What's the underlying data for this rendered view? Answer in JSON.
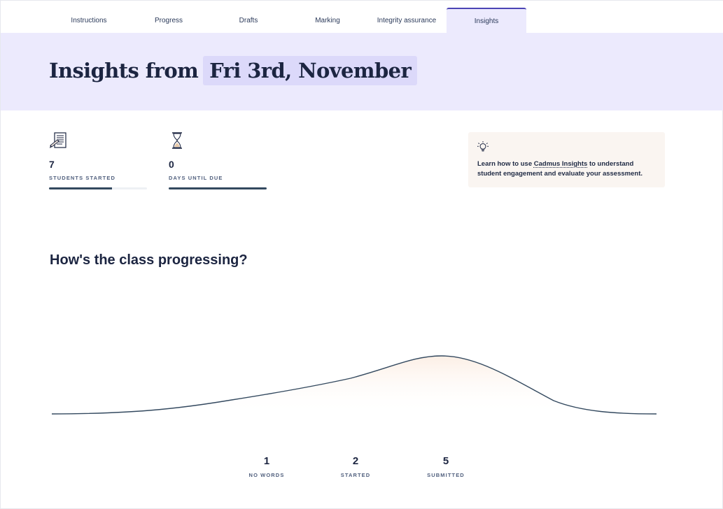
{
  "tabs": [
    {
      "label": "Instructions",
      "active": false
    },
    {
      "label": "Progress",
      "active": false
    },
    {
      "label": "Drafts",
      "active": false
    },
    {
      "label": "Marking",
      "active": false
    },
    {
      "label": "Integrity assurance",
      "active": false
    },
    {
      "label": "Insights",
      "active": true
    }
  ],
  "hero": {
    "prefix": "Insights from",
    "date": "Fri 3rd, November"
  },
  "stats": [
    {
      "icon": "document-pen-icon",
      "value": "7",
      "label": "STUDENTS STARTED",
      "progress": 0.64
    },
    {
      "icon": "hourglass-icon",
      "value": "0",
      "label": "DAYS UNTIL DUE",
      "progress": 1.0
    }
  ],
  "tip": {
    "icon": "lightbulb-icon",
    "text_before": "Learn how to use ",
    "link": "Cadmus Insights",
    "text_after": " to understand student engagement and evaluate your assessment."
  },
  "section": {
    "title": "How's the class progressing?"
  },
  "chart_data": {
    "type": "area",
    "categories": [
      "NO WORDS",
      "STARTED",
      "SUBMITTED"
    ],
    "values": [
      1,
      2,
      5
    ]
  },
  "colors": {
    "accent": "#4b44b5",
    "hero_bg": "#eceafd",
    "line": "#33495f",
    "tip_bg": "#faf5f1"
  }
}
